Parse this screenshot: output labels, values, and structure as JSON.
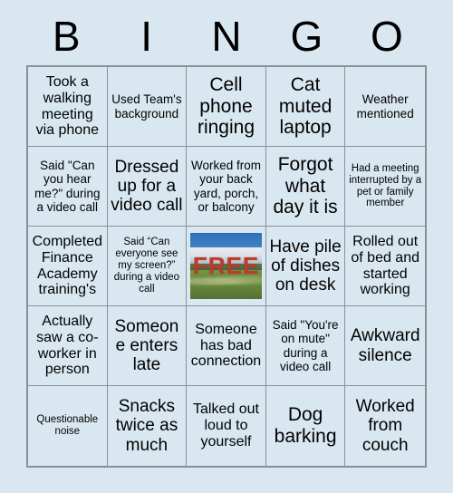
{
  "header": {
    "letters": [
      "B",
      "I",
      "N",
      "G",
      "O"
    ]
  },
  "free_space": {
    "label": "FREE",
    "image_description": "mountain landscape with snow capped peak, blue sky and green meadow",
    "label_color": "#c0392b"
  },
  "colors": {
    "page_background": "#d9e8f0",
    "cell_background": "#d9e8f0",
    "grid_line": "#8a9097",
    "text": "#000000"
  },
  "grid": {
    "rows": 5,
    "columns": 5,
    "cells": [
      {
        "text": "Took a walking meeting via phone",
        "size": "md"
      },
      {
        "text": "Used Team's background",
        "size": "sm"
      },
      {
        "text": "Cell phone ringing",
        "size": "xl"
      },
      {
        "text": "Cat muted laptop",
        "size": "xl"
      },
      {
        "text": "Weather mentioned",
        "size": "sm"
      },
      {
        "text": "Said \"Can you hear me?\" during a video call",
        "size": "sm"
      },
      {
        "text": "Dressed up for a video call",
        "size": "lg"
      },
      {
        "text": "Worked from your back yard, porch, or balcony",
        "size": "sm"
      },
      {
        "text": "Forgot what day it is",
        "size": "xl"
      },
      {
        "text": "Had a meeting interrupted by a pet or family member",
        "size": "xs"
      },
      {
        "text": "Completed Finance Academy training's",
        "size": "md"
      },
      {
        "text": "Said “Can everyone see my screen?” during a video call",
        "size": "xs"
      },
      {
        "text": "FREE",
        "size": "free"
      },
      {
        "text": "Have pile of dishes on desk",
        "size": "lg"
      },
      {
        "text": "Rolled out of bed and started working",
        "size": "md"
      },
      {
        "text": "Actually saw a co-worker in person",
        "size": "md"
      },
      {
        "text": "Someone enters late",
        "size": "lg"
      },
      {
        "text": "Someone has bad connection",
        "size": "md"
      },
      {
        "text": "Said \"You're on mute\" during a video call",
        "size": "sm"
      },
      {
        "text": "Awkward silence",
        "size": "lg"
      },
      {
        "text": "Questionable noise",
        "size": "xs"
      },
      {
        "text": "Snacks twice as much",
        "size": "lg"
      },
      {
        "text": "Talked out loud to yourself",
        "size": "md"
      },
      {
        "text": "Dog barking",
        "size": "xl"
      },
      {
        "text": "Worked from couch",
        "size": "lg"
      }
    ]
  }
}
